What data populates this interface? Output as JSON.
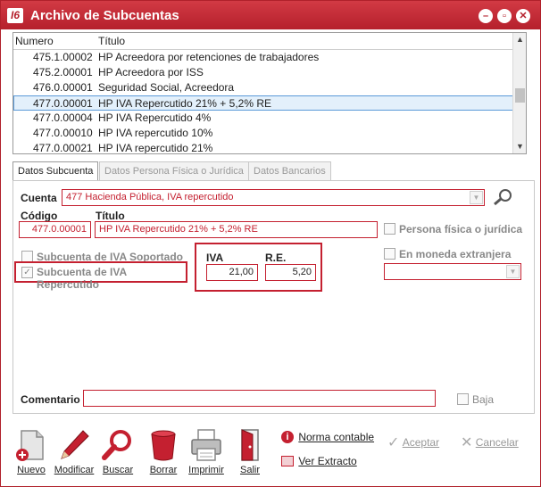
{
  "window": {
    "title": "Archivo de Subcuentas",
    "logo_text": "I6"
  },
  "list": {
    "headers": {
      "numero": "Numero",
      "titulo": "Título"
    },
    "rows": [
      {
        "numero": "475.1.00002",
        "titulo": "HP Acreedora por retenciones de trabajadores"
      },
      {
        "numero": "475.2.00001",
        "titulo": "HP Acreedora por ISS"
      },
      {
        "numero": "476.0.00001",
        "titulo": "Seguridad Social, Acreedora"
      },
      {
        "numero": "477.0.00001",
        "titulo": "HP IVA Repercutido 21% + 5,2% RE",
        "selected": true
      },
      {
        "numero": "477.0.00004",
        "titulo": "HP IVA Repercutido 4%"
      },
      {
        "numero": "477.0.00010",
        "titulo": "HP IVA repercutido 10%"
      },
      {
        "numero": "477.0.00021",
        "titulo": "HP IVA repercutido 21%"
      }
    ]
  },
  "tabs": [
    {
      "label": "Datos Subcuenta",
      "active": true
    },
    {
      "label": "Datos Persona Física o Jurídica",
      "active": false
    },
    {
      "label": "Datos Bancarios",
      "active": false
    }
  ],
  "form": {
    "cuenta_label": "Cuenta",
    "cuenta_value": "477   Hacienda Pública, IVA repercutido",
    "codigo_label": "Código",
    "codigo_value": "477.0.00001",
    "titulo_label": "Título",
    "titulo_value": "HP IVA Repercutido 21% + 5,2% RE",
    "persona_label": "Persona física o jurídica",
    "moneda_label": "En moneda extranjera",
    "moneda_value": "",
    "iva_soportado_label": "Subcuenta de IVA Soportado",
    "iva_repercutido_label": "Subcuenta de IVA Repercutido",
    "iva_label": "IVA",
    "iva_value": "21,00",
    "re_label": "R.E.",
    "re_value": "5,20",
    "comentario_label": "Comentario",
    "comentario_value": "",
    "baja_label": "Baja"
  },
  "toolbar": {
    "nuevo": "Nuevo",
    "modificar": "Modificar",
    "buscar": "Buscar",
    "borrar": "Borrar",
    "imprimir": "Imprimir",
    "salir": "Salir",
    "norma": "Norma contable",
    "extracto": "Ver Extracto",
    "aceptar": "Aceptar",
    "cancelar": "Cancelar"
  },
  "colors": {
    "accent": "#b5202c",
    "field_border": "#c42030",
    "selection": "#e3f0fb"
  }
}
